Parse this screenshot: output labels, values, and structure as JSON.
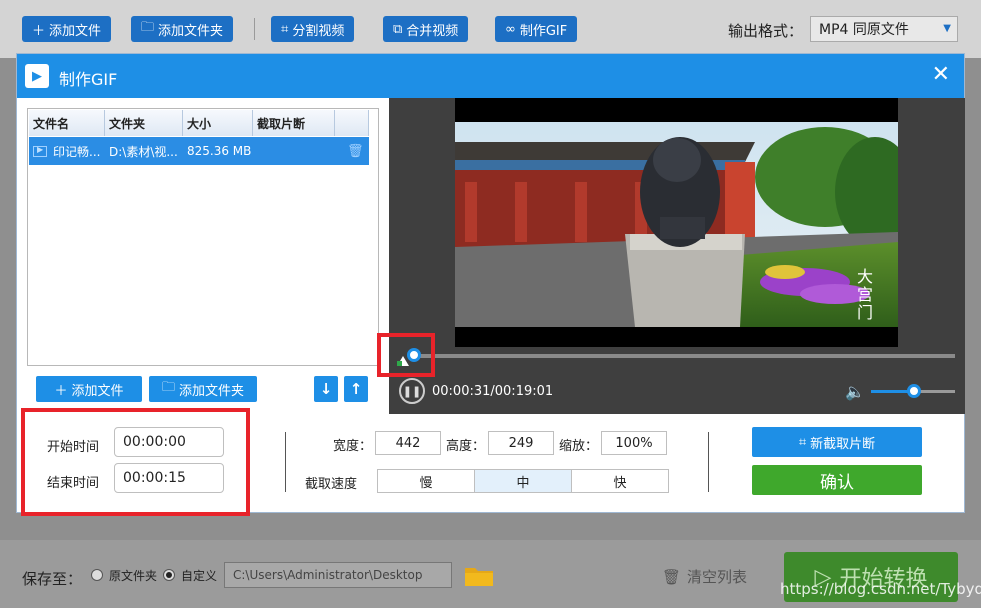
{
  "toolbar": {
    "add_file": "添加文件",
    "add_folder": "添加文件夹",
    "split_video": "分割视频",
    "merge_video": "合并视频",
    "make_gif": "制作GIF",
    "output_format_label": "输出格式：",
    "output_format_value": "MP4  同原文件"
  },
  "dialog": {
    "title": "制作GIF",
    "table": {
      "headers": [
        "文件名",
        "文件夹",
        "大小",
        "截取片断",
        ""
      ],
      "rows": [
        {
          "name": "印记畅...",
          "folder": "D:\\素材\\视...",
          "size": "825.36 MB"
        }
      ]
    },
    "add_file": "添加文件",
    "add_folder": "添加文件夹",
    "player": {
      "time": "00:00:31/00:19:01",
      "progress_fraction": 0.027,
      "volume_fraction": 0.5
    },
    "start_time_label": "开始时间",
    "start_time_value": "00:00:00",
    "end_time_label": "结束时间",
    "end_time_value": "00:00:15",
    "width_label": "宽度：",
    "width_value": "442",
    "height_label": "高度：",
    "height_value": "249",
    "scale_label": "缩放：",
    "scale_value": "100%",
    "speed_label": "截取速度",
    "speed_options": [
      "慢",
      "中",
      "快"
    ],
    "speed_selected": "中",
    "new_clip_button": "新截取片断",
    "confirm_button": "确认"
  },
  "bottom": {
    "save_to_label": "保存至：",
    "option_original": "原文件夹",
    "option_custom": "自定义",
    "path": "C:\\Users\\Administrator\\Desktop",
    "clear_list": "清空列表",
    "start_convert": "开始转换"
  },
  "watermark": "https://blog.csdn.net/Tybyqi",
  "colors": {
    "accent": "#1e8fe6",
    "confirm": "#3fa82c",
    "highlight": "#e8232a"
  }
}
